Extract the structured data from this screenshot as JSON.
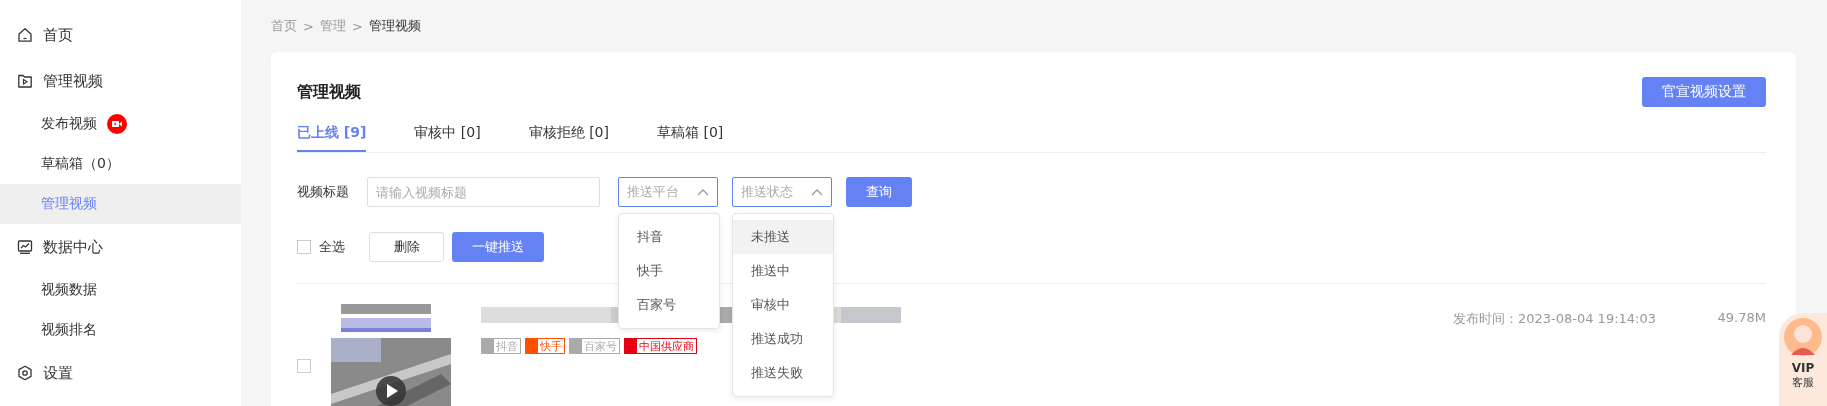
{
  "sidebar": {
    "items": [
      {
        "label": "首页",
        "selected": false
      },
      {
        "label": "管理视频",
        "selected": false,
        "children": [
          {
            "label": "发布视频",
            "badge": true,
            "selected": false
          },
          {
            "label": "草稿箱（0）",
            "badge": false,
            "selected": false
          },
          {
            "label": "管理视频",
            "badge": false,
            "selected": true
          }
        ]
      },
      {
        "label": "数据中心",
        "selected": false,
        "children": [
          {
            "label": "视频数据",
            "badge": false,
            "selected": false
          },
          {
            "label": "视频排名",
            "badge": false,
            "selected": false
          }
        ]
      },
      {
        "label": "设置",
        "selected": false
      }
    ]
  },
  "breadcrumb": [
    "首页",
    "管理",
    "管理视频"
  ],
  "breadcrumb_separator": ">",
  "page_title": "管理视频",
  "settings_button": "官宣视频设置",
  "tabs": [
    {
      "label": "已上线 [9]",
      "selected": true
    },
    {
      "label": "审核中 [0]",
      "selected": false
    },
    {
      "label": "审核拒绝 [0]",
      "selected": false
    },
    {
      "label": "草稿箱 [0]",
      "selected": false
    }
  ],
  "filter": {
    "label": "视频标题",
    "placeholder": "请输入视频标题",
    "selects": [
      {
        "placeholder": "推送平台",
        "open": true,
        "options": [
          {
            "label": "抖音",
            "highlighted": false
          },
          {
            "label": "快手",
            "highlighted": false
          },
          {
            "label": "百家号",
            "highlighted": false
          }
        ]
      },
      {
        "placeholder": "推送状态",
        "open": true,
        "options": [
          {
            "label": "未推送",
            "highlighted": true
          },
          {
            "label": "推送中",
            "highlighted": false
          },
          {
            "label": "审核中",
            "highlighted": false
          },
          {
            "label": "推送成功",
            "highlighted": false
          },
          {
            "label": "推送失败",
            "highlighted": false
          }
        ]
      }
    ],
    "query_button": "查询"
  },
  "bulk": {
    "select_all": {
      "label": "全选",
      "checked": false
    },
    "delete_button": "删除",
    "push_button": "一键推送"
  },
  "videos": [
    {
      "checked": false,
      "platforms": [
        {
          "label": "抖音",
          "color": "#aaaaaa",
          "filled": false
        },
        {
          "label": "快手",
          "color": "#ff5000",
          "filled": false
        },
        {
          "label": "百家号",
          "color": "#aaaaaa",
          "filled": false
        },
        {
          "label": "中国供应商",
          "color": "#e60012",
          "filled": false
        }
      ],
      "published": "发布时间：2023-08-04 19:14:03",
      "size": "49.78M"
    }
  ],
  "support": {
    "line1": "VIP",
    "line2": "客服"
  }
}
